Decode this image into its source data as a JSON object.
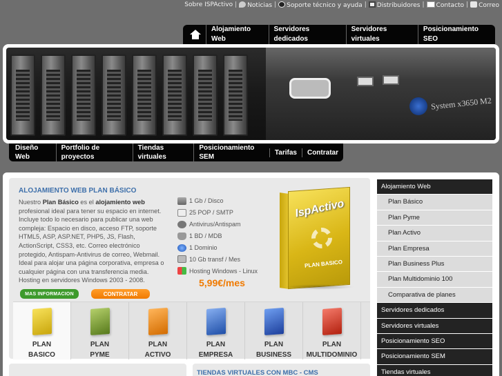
{
  "top_links": {
    "about": "Sobre ISPActivo",
    "news": "Noticias",
    "support": "Soporte técnico y ayuda",
    "distributors": "Distribuidores",
    "contact": "Contacto",
    "mail": "Correo"
  },
  "main_nav": {
    "items": [
      "Alojamiento Web",
      "Servidores dedicados",
      "Servidores virtuales",
      "Posicionamiento SEO"
    ]
  },
  "banner": {
    "system_text": "System x3650 M2"
  },
  "sub_nav": {
    "items": [
      "Diseño Web",
      "Portfolio de proyectos",
      "Tiendas virtuales",
      "Posicionamiento SEM",
      "Tarifas",
      "Contratar"
    ]
  },
  "feature": {
    "title": "Alojamiento web plan Básico",
    "desc_intro": "Nuestro ",
    "desc_plan": "Plan Básico",
    "desc_mid": " es el ",
    "desc_product": "alojamiento web",
    "desc_rest": " profesional ideal para tener su espacio en internet. Incluye todo lo necesario para publicar una web compleja: Espacio en disco, acceso FTP, soporte HTML5, ASP, ASP.NET, PHP5, JS, Flash, ActionScript, CSS3, etc. Correo electrónico protegido, Antispam-Antivirus de correo, Webmail. Ideal para alojar una página corporativa, empresa o cualquier página con una transferencia media. Hosting en servidores Windows 2003 - 2008.",
    "btn_info": "MAS INFORMACION",
    "btn_contract": "CONTRATAR",
    "specs": [
      {
        "icon": "disk-icon",
        "text": "1 Gb / Disco"
      },
      {
        "icon": "mail-icon",
        "text": "25 POP / SMTP"
      },
      {
        "icon": "shield-icon",
        "text": "Antivirus/Antispam"
      },
      {
        "icon": "database-icon",
        "text": "1 BD / MDB"
      },
      {
        "icon": "globe-icon",
        "text": "1 Dominio"
      },
      {
        "icon": "network-icon",
        "text": "10 Gb transf / Mes"
      },
      {
        "icon": "windows-icon",
        "text": "Hosting Windows - Linux"
      }
    ],
    "price": "5,99€/mes",
    "box_brand": "IspActivo",
    "box_plan": "PLAN BASICO"
  },
  "plan_tabs": [
    {
      "line1": "Plan",
      "line2": "Basico",
      "color": "c-basico"
    },
    {
      "line1": "Plan",
      "line2": "Pyme",
      "color": "c-pyme"
    },
    {
      "line1": "Plan",
      "line2": "Activo",
      "color": "c-activo"
    },
    {
      "line1": "Plan",
      "line2": "Empresa",
      "color": "c-empresa"
    },
    {
      "line1": "Plan",
      "line2": "Business",
      "color": "c-business"
    },
    {
      "line1": "Plan",
      "line2": "Multidominio",
      "color": "c-multi"
    }
  ],
  "bottom": {
    "right_title": "Tiendas virtuales con MBC - CMS"
  },
  "side_menu": [
    {
      "label": "Alojamiento Web",
      "level": "top"
    },
    {
      "label": "Plan Básico",
      "level": "sub"
    },
    {
      "label": "Plan Pyme",
      "level": "sub"
    },
    {
      "label": "Plan Activo",
      "level": "sub"
    },
    {
      "label": "Plan Empresa",
      "level": "sub"
    },
    {
      "label": "Plan Business Plus",
      "level": "sub"
    },
    {
      "label": "Plan Multidominio 100",
      "level": "sub"
    },
    {
      "label": "Comparativa de planes",
      "level": "sub"
    },
    {
      "label": "Servidores dedicados",
      "level": "top"
    },
    {
      "label": "Servidores virtuales",
      "level": "top"
    },
    {
      "label": "Posicionamiento SEO",
      "level": "top"
    },
    {
      "label": "Posicionamiento SEM",
      "level": "top"
    },
    {
      "label": "Tiendas virtuales",
      "level": "top"
    }
  ]
}
